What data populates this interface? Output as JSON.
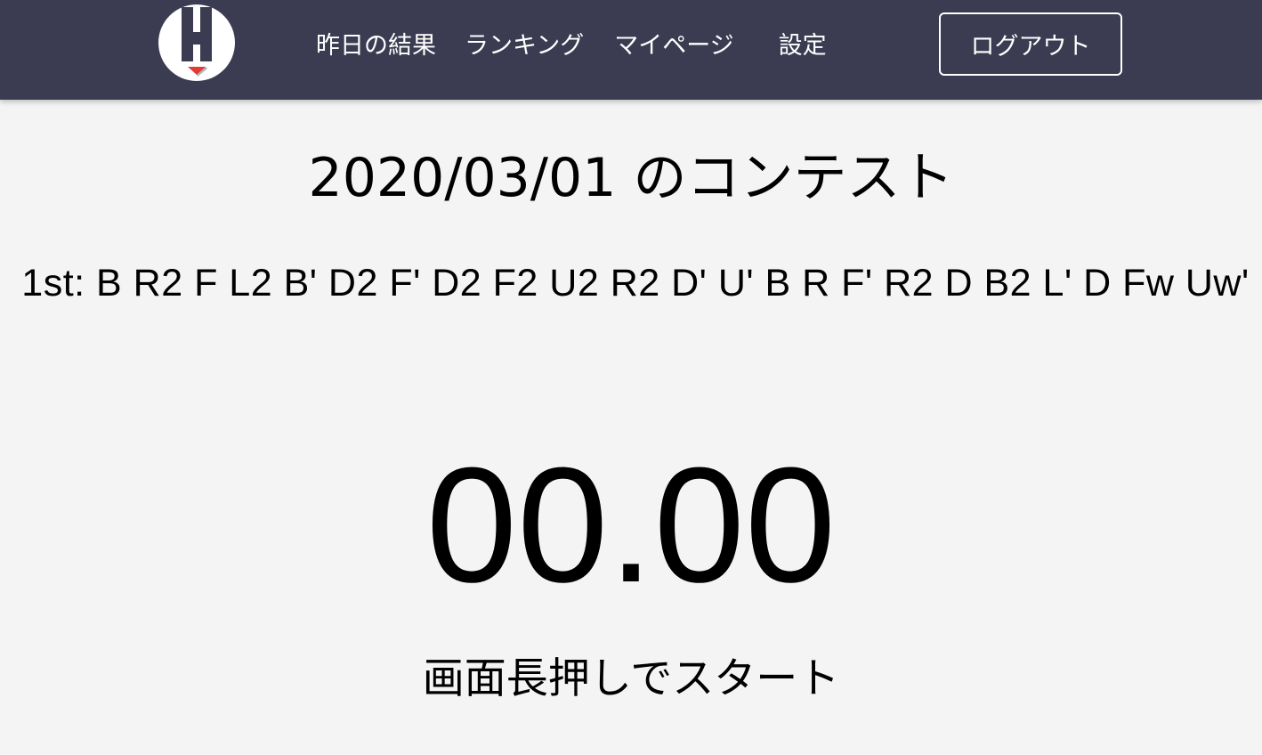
{
  "nav": {
    "links": [
      {
        "label": "昨日の結果"
      },
      {
        "label": "ランキング"
      },
      {
        "label": "マイページ"
      },
      {
        "label": "設定"
      }
    ],
    "logout_label": "ログアウト",
    "background_color": "#3b3c51"
  },
  "logo": {
    "icon": "h-cube-logo-icon",
    "accent_color": "#e53935"
  },
  "main": {
    "contest_title": "2020/03/01 のコンテスト",
    "scramble": "1st: B R2 F L2 B' D2 F' D2 F2 U2 R2 D' U' B R F' R2 D B2 L' D Fw Uw'",
    "timer": "00.00",
    "start_hint": "画面長押しでスタート"
  }
}
